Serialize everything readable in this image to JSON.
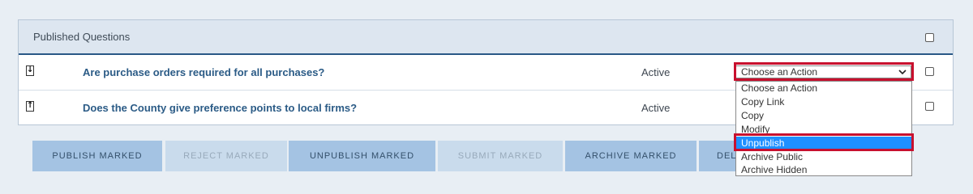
{
  "panel": {
    "title": "Published Questions"
  },
  "rows": [
    {
      "question": "Are purchase orders required for all purchases?",
      "status": "Active",
      "move_icon": "down-arrow-icon",
      "move_glyph": "↓"
    },
    {
      "question": "Does the County give preference points to local firms?",
      "status": "Active",
      "move_icon": "up-arrow-icon",
      "move_glyph": "↑"
    }
  ],
  "action_select": {
    "value": "Choose an Action",
    "options": [
      "Choose an Action",
      "Copy Link",
      "Copy",
      "Modify",
      "Unpublish",
      "Archive Public",
      "Archive Hidden"
    ],
    "highlighted": "Unpublish"
  },
  "buttons": {
    "publish": "PUBLISH MARKED",
    "reject": "REJECT MARKED",
    "unpublish": "UNPUBLISH MARKED",
    "submit": "SUBMIT MARKED",
    "archive": "ARCHIVE MARKED",
    "delete": "DEL"
  },
  "colors": {
    "highlight_outline": "#c8102e",
    "selected_option": "#1e90ff",
    "header_rule": "#2a5886"
  }
}
